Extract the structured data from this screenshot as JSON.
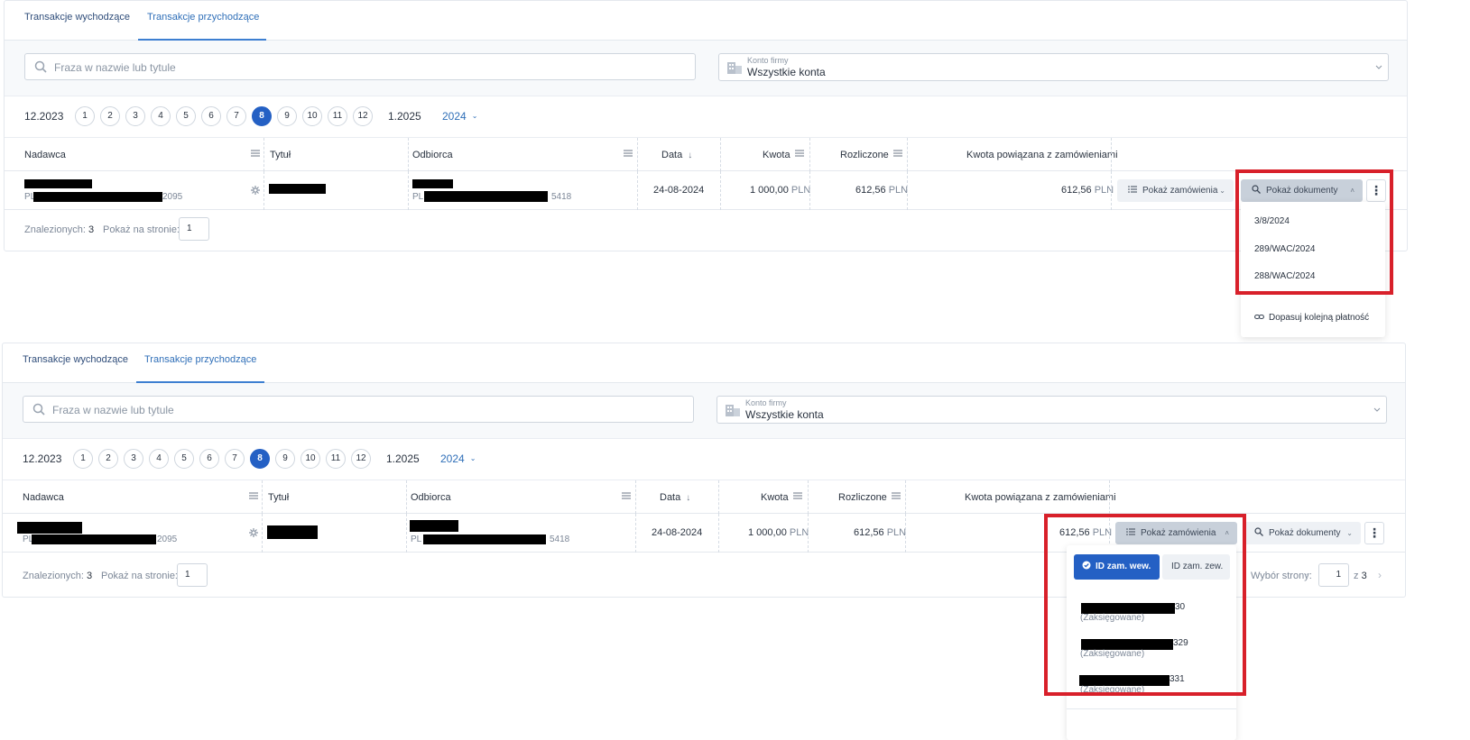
{
  "tabs": [
    {
      "label": "Transakcje wychodzące"
    },
    {
      "label": "Transakcje przychodzące"
    }
  ],
  "search": {
    "placeholder": "Fraza w nazwie lub tytule"
  },
  "account_select": {
    "label": "Konto firmy",
    "value": "Wszystkie konta"
  },
  "months": {
    "prev_label": "12.2023",
    "numbers": [
      "1",
      "2",
      "3",
      "4",
      "5",
      "6",
      "7",
      "8",
      "9",
      "10",
      "11",
      "12"
    ],
    "active": "8",
    "next_label": "1.2025",
    "year": "2024"
  },
  "columns": {
    "sender": "Nadawca",
    "title": "Tytuł",
    "recipient": "Odbiorca",
    "date": "Data",
    "amount": "Kwota",
    "settled": "Rozliczone",
    "linked": "Kwota powiązana z zamówieniami"
  },
  "row": {
    "sender_prefix": "PL",
    "sender_suffix": "2095",
    "recipient_prefix": "PL",
    "recipient_suffix": "5418",
    "date": "24-08-2024",
    "amount": "1 000,00",
    "settled": "612,56",
    "linked": "612,56",
    "currency": "PLN"
  },
  "buttons": {
    "show_orders": "Pokaż zamówienia",
    "show_documents": "Pokaż dokumenty",
    "more": "⋮"
  },
  "footer": {
    "found_label": "Znalezionych:",
    "found_count": "3",
    "per_page_label": "Pokaż na stronie:",
    "per_page_value": "1",
    "page_select_label": "Wybór strony:",
    "page_value": "1",
    "page_of": "z",
    "page_total": "3"
  },
  "documents_dropdown": {
    "items": [
      "3/8/2024",
      "289/WAC/2024",
      "288/WAC/2024"
    ],
    "match_link": "Dopasuj kolejną płatność"
  },
  "orders_dropdown": {
    "toggle_internal": "ID zam. wew.",
    "toggle_external": "ID zam. zew.",
    "items": [
      {
        "suffix": "30",
        "status": "(Zaksięgowane)"
      },
      {
        "suffix": "329",
        "status": "(Zaksięgowane)"
      },
      {
        "suffix": "331",
        "status": "(Zaksięgowane)"
      }
    ]
  },
  "colors": {
    "accent": "#2460c4",
    "highlight_border": "#d8202a",
    "tab_active": "#2f6fb8"
  },
  "icons": [
    "search-icon",
    "building-icon",
    "chevron-down-icon",
    "column-menu-icon",
    "sort-down-icon",
    "gear-icon",
    "list-icon",
    "link-icon",
    "check-circle-icon"
  ]
}
